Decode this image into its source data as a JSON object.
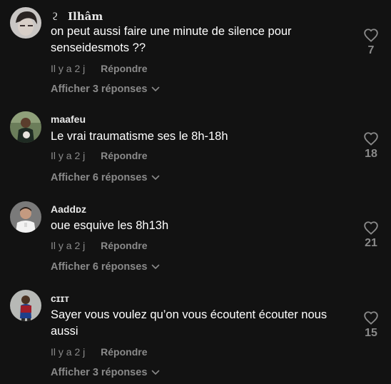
{
  "comments": [
    {
      "username": "Ilhâm",
      "text": "on peut aussi faire une minute de silence pour senseidesmots ??",
      "time": "Il y a 2 j",
      "reply_label": "Répondre",
      "replies_label": "Afficher 3 réponses",
      "likes": "7"
    },
    {
      "username": "maafeu",
      "text": "Le vrai traumatisme ses le 8h-18h",
      "time": "Il y a 2 j",
      "reply_label": "Répondre",
      "replies_label": "Afficher 6 réponses",
      "likes": "18"
    },
    {
      "username": "Aaddᴅᴢ",
      "text": "oue esquive les 8h13h",
      "time": "Il y a 2 j",
      "reply_label": "Répondre",
      "replies_label": "Afficher 6 réponses",
      "likes": "21"
    },
    {
      "username": "ᴄɪɪᴛ",
      "text": "Sayer vous voulez qu’on vous écoutent écouter nous aussi",
      "time": "Il y a 2 j",
      "reply_label": "Répondre",
      "replies_label": "Afficher 3 réponses",
      "likes": "15"
    }
  ],
  "colors": {
    "background": "#121212",
    "primary_text": "#ffffff",
    "secondary_text": "#8a8a8a"
  },
  "icons": {
    "like": "heart-outline-icon",
    "expand": "chevron-down-icon"
  }
}
